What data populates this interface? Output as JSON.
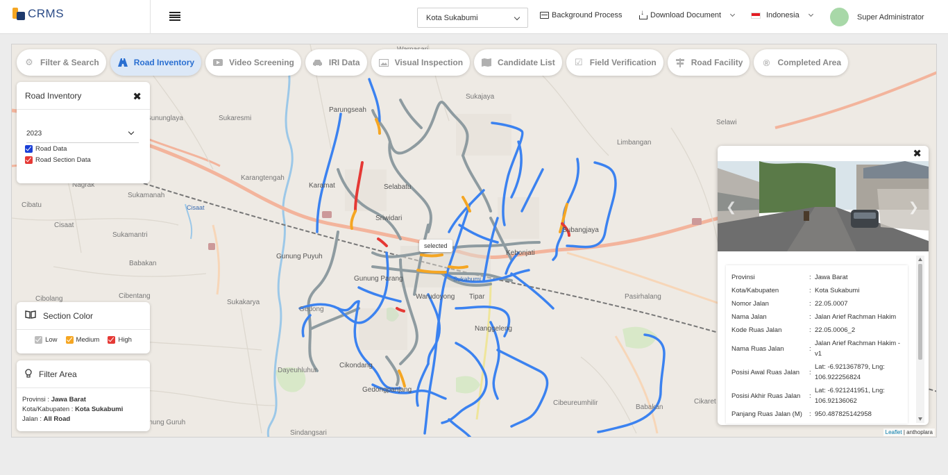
{
  "app": {
    "title": "CRMS",
    "city_select": "Kota Sukabumi",
    "background_process": "Background Process",
    "download_document": "Download Document",
    "language": "Indonesia",
    "user_name": "Super Administrator"
  },
  "tabs": [
    {
      "label": "Filter & Search",
      "icon": "gear-icon",
      "active": false
    },
    {
      "label": "Road Inventory",
      "icon": "road-icon",
      "active": true
    },
    {
      "label": "Video Screening",
      "icon": "video-icon",
      "active": false
    },
    {
      "label": "IRI Data",
      "icon": "car-icon",
      "active": false
    },
    {
      "label": "Visual Inspection",
      "icon": "image-icon",
      "active": false
    },
    {
      "label": "Candidate List",
      "icon": "map-icon",
      "active": false
    },
    {
      "label": "Field Verification",
      "icon": "check-icon",
      "active": false
    },
    {
      "label": "Road Facility",
      "icon": "sign-icon",
      "active": false
    },
    {
      "label": "Completed Area",
      "icon": "registered-icon",
      "active": false
    }
  ],
  "road_inventory": {
    "title": "Road Inventory",
    "year": "2023",
    "checkboxes": [
      {
        "label": "Road Data",
        "checked": true,
        "color": "#1a3fd6"
      },
      {
        "label": "Road Section Data",
        "checked": true,
        "color": "#e53935"
      }
    ]
  },
  "section_color": {
    "title": "Section Color",
    "items": [
      {
        "label": "Low",
        "color": "#bdbdbd"
      },
      {
        "label": "Medium",
        "color": "#f5a623"
      },
      {
        "label": "High",
        "color": "#e53935"
      }
    ]
  },
  "filter_area": {
    "title": "Filter Area",
    "provinsi_label": "Provinsi : ",
    "provinsi": "Jawa Barat",
    "kota_label": "Kota/Kabupaten : ",
    "kota": "Kota Sukabumi",
    "jalan_label": "Jalan : ",
    "jalan": "All Road"
  },
  "map": {
    "selected_tag": "selected",
    "attribution_link": "Leaflet",
    "attribution_rest": " | anthoplara",
    "labels": [
      {
        "text": "Warnasari"
      },
      {
        "text": "Sukajaya"
      },
      {
        "text": "Gununglaya"
      },
      {
        "text": "Sukaresmi"
      },
      {
        "text": "Parungseah"
      },
      {
        "text": "Selawi"
      },
      {
        "text": "Limbangan"
      },
      {
        "text": "Karangtengah"
      },
      {
        "text": "Nagrak"
      },
      {
        "text": "Sukamanah"
      },
      {
        "text": "Cibatu"
      },
      {
        "text": "Cisaat"
      },
      {
        "text": "Sukamantri"
      },
      {
        "text": "Babakan"
      },
      {
        "text": "Cibolang"
      },
      {
        "text": "Cibentang"
      },
      {
        "text": "Sukakarya"
      },
      {
        "text": "Gunung Puyuh"
      },
      {
        "text": "Gunung Parang"
      },
      {
        "text": "Warudoyong"
      },
      {
        "text": "Tipar"
      },
      {
        "text": "Nanggeleng"
      },
      {
        "text": "Kebonjati"
      },
      {
        "text": "Subangjaya"
      },
      {
        "text": "Sriwidari"
      },
      {
        "text": "Selabatu"
      },
      {
        "text": "Karamat"
      },
      {
        "text": "Sukabumi"
      },
      {
        "text": "Cikondang"
      },
      {
        "text": "Gedongpanjang"
      },
      {
        "text": "Dayeuhluhur"
      },
      {
        "text": "Pasirhalang"
      },
      {
        "text": "Sindangsari"
      },
      {
        "text": "Gunung Guruh"
      },
      {
        "text": "Cibeureumhilir"
      },
      {
        "text": "Babakan"
      },
      {
        "text": "Cikaret"
      },
      {
        "text": "Cisaat"
      },
      {
        "text": "Gedong"
      }
    ]
  },
  "detail": {
    "rows": [
      {
        "key": "Provinsi",
        "value": "Jawa Barat"
      },
      {
        "key": "Kota/Kabupaten",
        "value": "Kota Sukabumi"
      },
      {
        "key": "Nomor Jalan",
        "value": "22.05.0007"
      },
      {
        "key": "Nama Jalan",
        "value": "Jalan Arief Rachman Hakim"
      },
      {
        "key": "Kode Ruas Jalan",
        "value": "22.05.0006_2"
      },
      {
        "key": "Nama Ruas Jalan",
        "value": "Jalan Arief Rachman Hakim - v1"
      },
      {
        "key": "Posisi Awal Ruas Jalan",
        "value": "Lat: -6.921367879, Lng: 106.922256824"
      },
      {
        "key": "Posisi Akhir Ruas Jalan",
        "value": "Lat: -6.921241951, Lng: 106.92136062"
      },
      {
        "key": "Panjang Ruas Jalan (M)",
        "value": "950.487825142958"
      }
    ]
  }
}
